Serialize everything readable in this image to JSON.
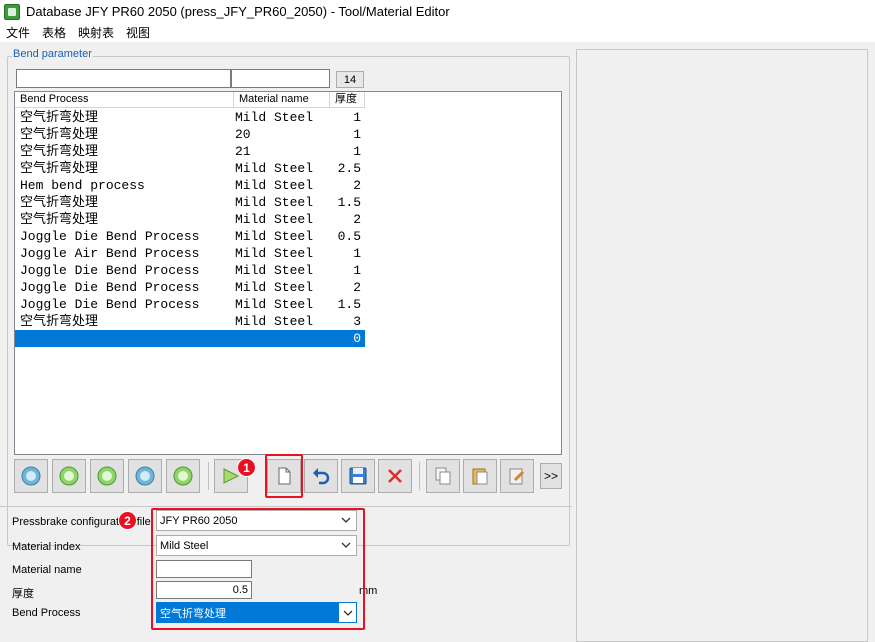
{
  "window": {
    "title": "Database JFY PR60 2050 (press_JFY_PR60_2050) - Tool/Material Editor"
  },
  "menu": [
    "文件",
    "表格",
    "映射表",
    "视图"
  ],
  "bend_parameter": {
    "group_label": "Bend parameter",
    "filter_process": "",
    "filter_material": "",
    "count": "14",
    "columns": [
      "Bend Process",
      "Material name",
      "厚度"
    ],
    "rows": [
      {
        "process": "空气折弯处理",
        "material": "Mild Steel",
        "thickness": "1"
      },
      {
        "process": "空气折弯处理",
        "material": "20",
        "thickness": "1"
      },
      {
        "process": "空气折弯处理",
        "material": "21",
        "thickness": "1"
      },
      {
        "process": "空气折弯处理",
        "material": "Mild Steel",
        "thickness": "2.5"
      },
      {
        "process": "Hem bend process",
        "material": "Mild Steel",
        "thickness": "2"
      },
      {
        "process": "空气折弯处理",
        "material": "Mild Steel",
        "thickness": "1.5"
      },
      {
        "process": "空气折弯处理",
        "material": "Mild Steel",
        "thickness": "2"
      },
      {
        "process": "Joggle Die Bend Process",
        "material": "Mild Steel",
        "thickness": "0.5"
      },
      {
        "process": "Joggle Air Bend Process",
        "material": "Mild Steel",
        "thickness": "1"
      },
      {
        "process": "Joggle Die Bend Process",
        "material": "Mild Steel",
        "thickness": "1"
      },
      {
        "process": "Joggle Die Bend Process",
        "material": "Mild Steel",
        "thickness": "2"
      },
      {
        "process": "Joggle Die Bend Process",
        "material": "Mild Steel",
        "thickness": "1.5"
      },
      {
        "process": "空气折弯处理",
        "material": "Mild Steel",
        "thickness": "3"
      },
      {
        "process": "",
        "material": "",
        "thickness": "0"
      }
    ],
    "selected_row_index": 13
  },
  "toolbar": {
    "more_label": ">>",
    "badge_1": "1",
    "badge_2": "2",
    "icons": [
      "first-icon",
      "previous-icon",
      "next-icon",
      "last-icon",
      "refresh-icon",
      "apply-icon",
      "new-icon",
      "undo-icon",
      "save-icon",
      "delete-icon",
      "copy-icon",
      "paste-icon",
      "edit-icon"
    ]
  },
  "form": {
    "pressbrake_label": "Pressbrake configuration file",
    "pressbrake_value": "JFY PR60 2050",
    "material_index_label": "Material index",
    "material_index_value": "Mild Steel",
    "material_name_label": "Material name",
    "material_name_value": "",
    "thickness_label": "厚度",
    "thickness_value": "0.5",
    "thickness_unit": "mm",
    "bend_process_label": "Bend Process",
    "bend_process_value": "空气折弯处理"
  },
  "colors": {
    "selection": "#0078d7",
    "highlight": "#e81123",
    "group_label": "#1a5fb4"
  }
}
